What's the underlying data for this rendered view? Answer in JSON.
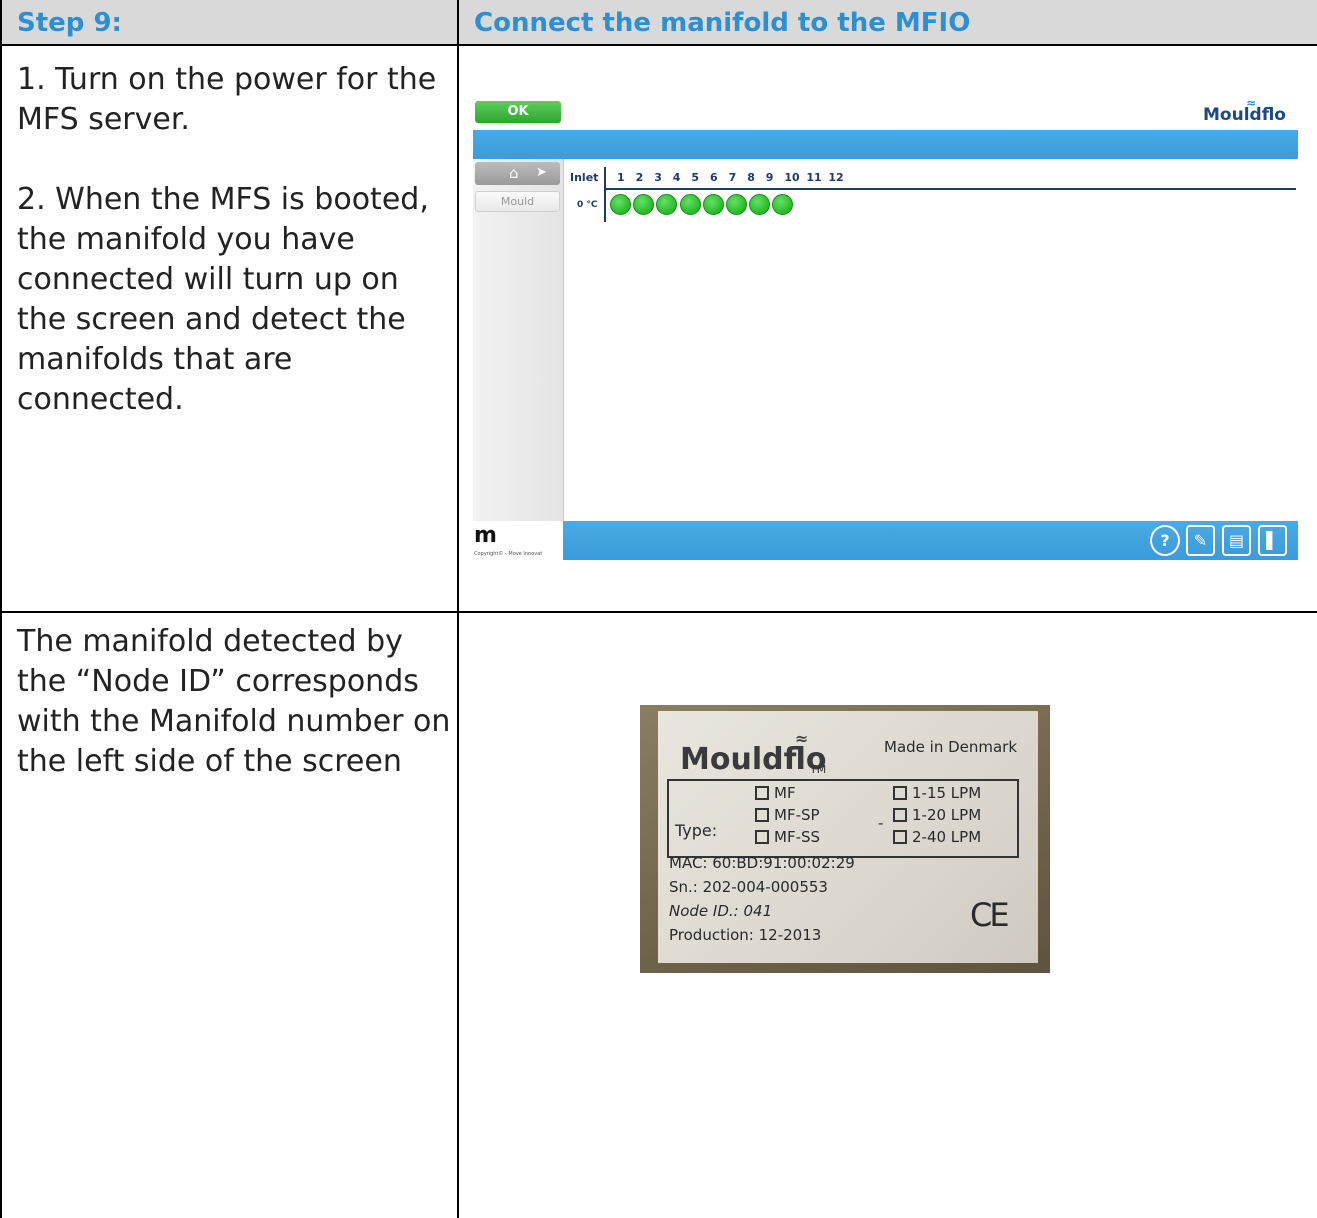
{
  "table": {
    "header": {
      "step": "Step 9:",
      "title": "Connect the manifold to the MFIO"
    },
    "row1": {
      "instruction1": "1. Turn on the power for the MFS server.",
      "instruction2": "2. When the MFS is booted, the manifold you have connected will turn up on the screen and detect the manifolds that are connected."
    },
    "row2": {
      "text": "The manifold detected by the “Node ID” corresponds with the Manifold number on the left side of the screen"
    }
  },
  "colors": {
    "header_bg": "#d9d9d9",
    "header_text": "#2e8fd0",
    "app_bar": "#3b9bdb",
    "status_ok": "#2ebf2e"
  },
  "app": {
    "ok_label": "OK",
    "logo": "Mouldflo",
    "home_icon": "home-icon",
    "mould_tab": "Mould",
    "inlet_label": "Inlet",
    "inlet_numbers": [
      "1",
      "2",
      "3",
      "4",
      "5",
      "6",
      "7",
      "8",
      "9",
      "10",
      "11",
      "12"
    ],
    "temperature": "0 °C",
    "active_inlets": 8,
    "footer_logo": "m",
    "copyright": "Copyright© - Move Innovat",
    "toolbar_icons": [
      "help-icon",
      "wrench-icon",
      "notes-icon",
      "exit-icon"
    ]
  },
  "label": {
    "brand": "Mouldflo",
    "tm": "TM",
    "made_in": "Made in Denmark",
    "type_label": "Type:",
    "types": [
      "MF",
      "MF-SP",
      "MF-SS"
    ],
    "dash": "-",
    "flows": [
      "1-15 LPM",
      "1-20 LPM",
      "2-40 LPM"
    ],
    "mac": "MAC: 60:BD:91:00:02:29",
    "sn": "Sn.: 202-004-000553",
    "node_id": "Node ID.: 041",
    "production": "Production: 12-2013",
    "ce": "CE"
  }
}
